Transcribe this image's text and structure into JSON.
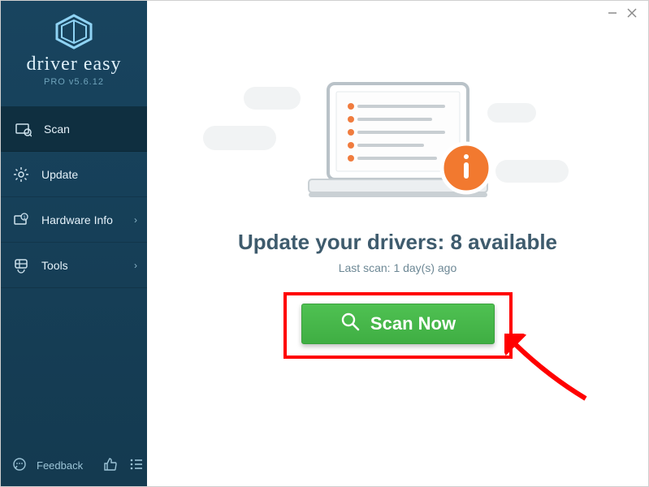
{
  "brand": {
    "name": "driver easy",
    "sub": "PRO v5.6.12"
  },
  "sidebar": {
    "items": [
      {
        "label": "Scan"
      },
      {
        "label": "Update"
      },
      {
        "label": "Hardware Info"
      },
      {
        "label": "Tools"
      }
    ],
    "feedback": "Feedback"
  },
  "main": {
    "headline": "Update your drivers: 8 available",
    "subline": "Last scan: 1 day(s) ago",
    "scan_label": "Scan Now"
  }
}
